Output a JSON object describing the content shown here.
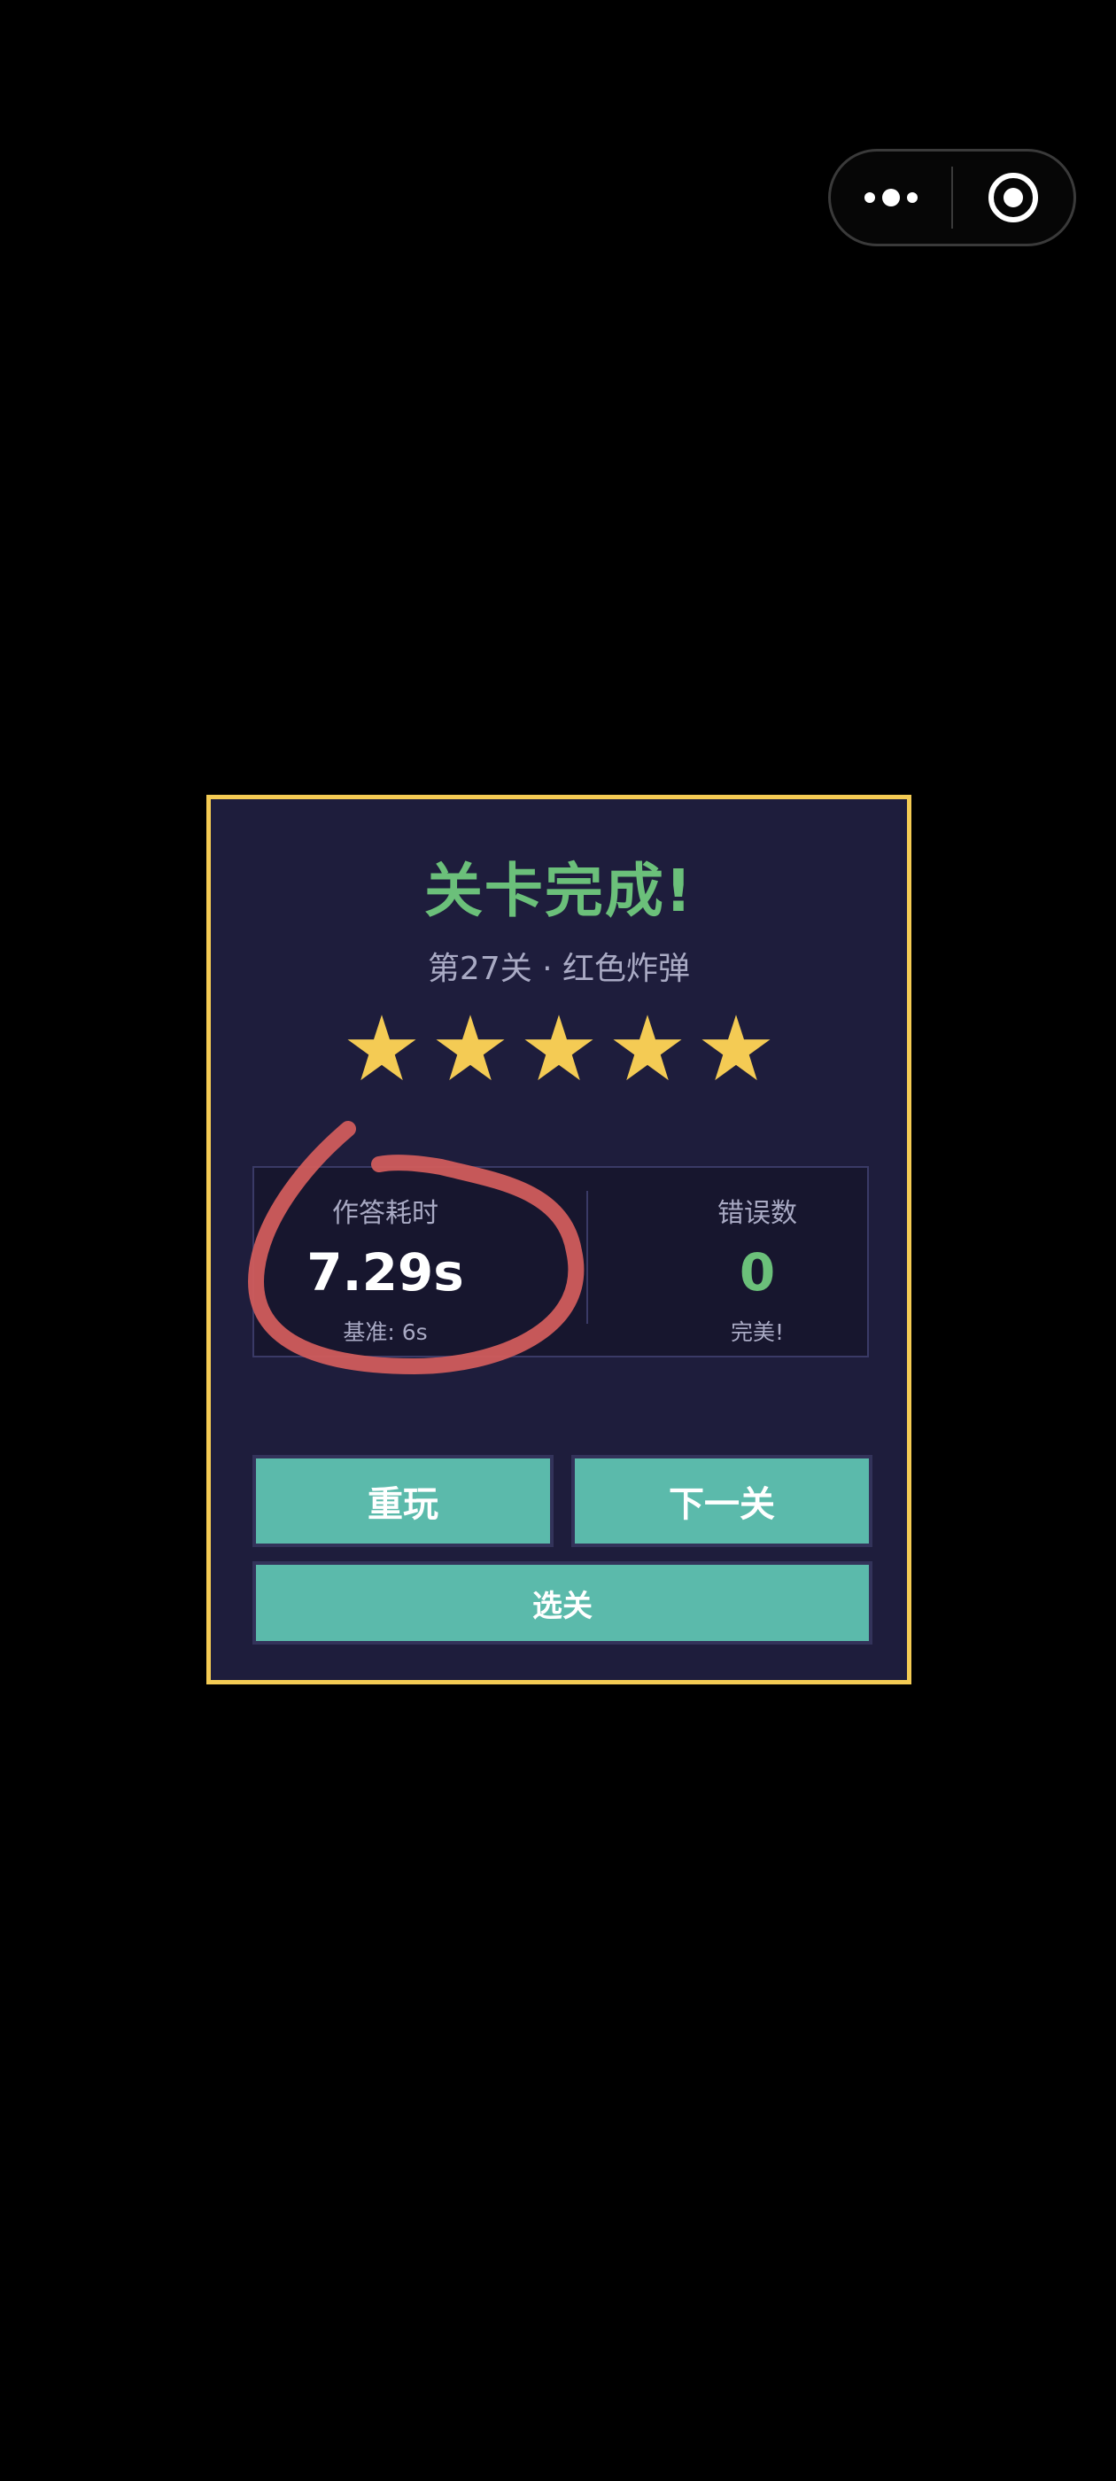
{
  "capsule": {
    "menu_icon": "more-dots-icon",
    "close_icon": "target-circle-icon"
  },
  "dialog": {
    "title": "关卡完成!",
    "subtitle": "第27关 · 红色炸弹",
    "stars": {
      "earned": 5,
      "total": 5,
      "icon": "star-icon",
      "color": "#f4cb54"
    },
    "stats": {
      "time": {
        "label": "作答耗时",
        "value": "7.29s",
        "note": "基准: 6s"
      },
      "errors": {
        "label": "错误数",
        "value": "0",
        "note": "完美!"
      }
    },
    "buttons": {
      "replay": "重玩",
      "next": "下一关",
      "select": "选关"
    }
  },
  "colors": {
    "border_gold": "#f4cb54",
    "title_green": "#6bc07a",
    "button_teal": "#5bbaab",
    "panel_bg": "#1e1d3c",
    "annotation_red": "#d05c5c"
  }
}
